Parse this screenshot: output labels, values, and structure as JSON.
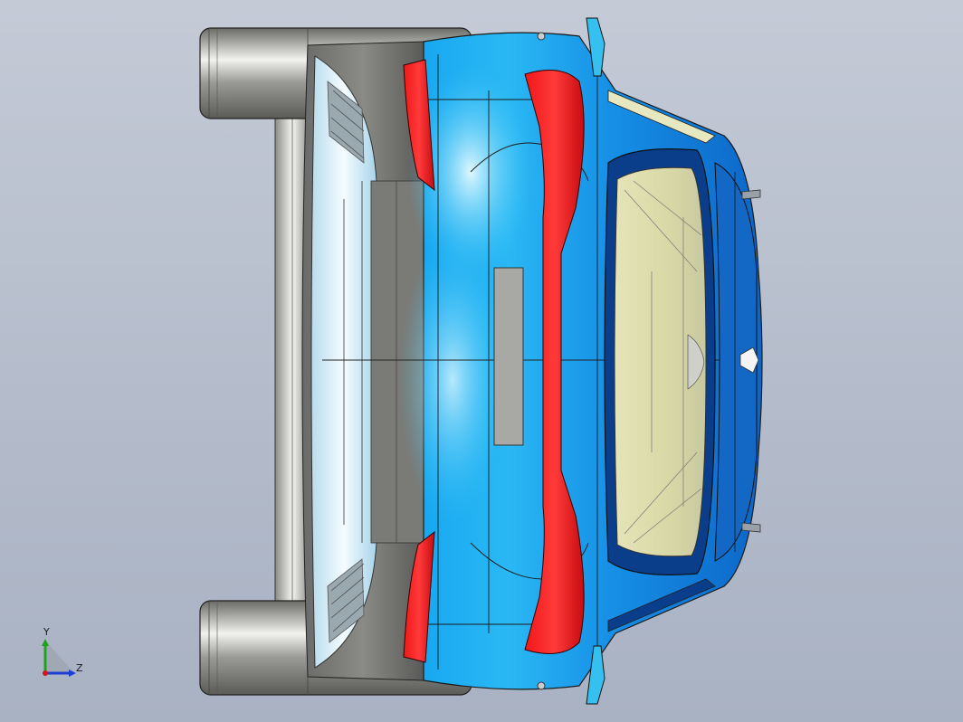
{
  "viewport": {
    "background_top": "#c4cad6",
    "background_bottom": "#a9b2c3"
  },
  "model": {
    "body_color": "#1478d4",
    "accent_color": "#e8141a",
    "glass_color": "#dcdcaa",
    "tire_color": "#8e8e8a",
    "grille_color": "#d8ecf4"
  },
  "triad": {
    "y_label": "Y",
    "z_label": "Z",
    "y_color": "#1fa21f",
    "z_color": "#1b3fd6",
    "x_color": "#d01818"
  }
}
